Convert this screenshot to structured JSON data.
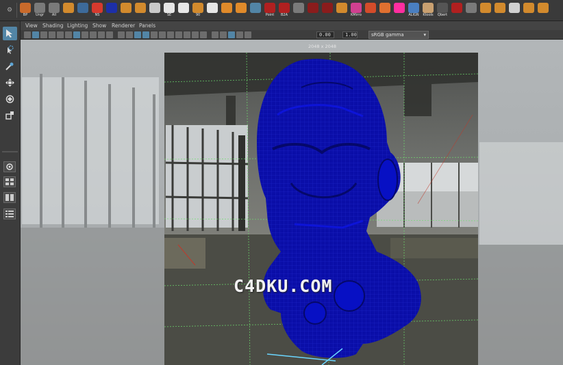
{
  "shelf": {
    "buttons": [
      {
        "label": "BP",
        "icon": "axis-arrows-icon",
        "color": "#c96a2b"
      },
      {
        "label": "Ungr",
        "icon": "ungroup-icon",
        "color": "#7a7a7a"
      },
      {
        "label": "All",
        "icon": "select-all-icon",
        "color": "#7a7a7a"
      },
      {
        "label": "",
        "icon": "grid-tiles-icon",
        "color": "#d28a2d"
      },
      {
        "label": "",
        "icon": "checker-icon",
        "color": "#3d6a9a"
      },
      {
        "label": "NS",
        "icon": "red-cylinder-icon",
        "color": "#d63a2e"
      },
      {
        "label": "",
        "icon": "blue-panel-icon",
        "color": "#1d2fa8"
      },
      {
        "label": "",
        "icon": "sphere-orange-icon",
        "color": "#d28a2d"
      },
      {
        "label": "",
        "icon": "sphere-orange-icon",
        "color": "#d28a2d"
      },
      {
        "label": "",
        "icon": "globe-icon",
        "color": "#c9c9c9"
      },
      {
        "label": "SE",
        "icon": "tiles-icon",
        "color": "#e6e6e6"
      },
      {
        "label": "",
        "icon": "grid-dots-icon",
        "color": "#e6e6e6"
      },
      {
        "label": "90",
        "icon": "rotate-icon",
        "color": "#d28a2d"
      },
      {
        "label": "",
        "icon": "brush-icon",
        "color": "#e6e6e6"
      },
      {
        "label": "",
        "icon": "palette-icon",
        "color": "#e08a2a"
      },
      {
        "label": "",
        "icon": "paint-icon",
        "color": "#e08a2a"
      },
      {
        "label": "",
        "icon": "brush-blue-icon",
        "color": "#5285a6"
      },
      {
        "label": "Point",
        "icon": "point-icon",
        "color": "#b02020"
      },
      {
        "label": "B2A",
        "icon": "b2a-icon",
        "color": "#b02020"
      },
      {
        "label": "",
        "icon": "transfer-icon",
        "color": "#7a7a7a"
      },
      {
        "label": "",
        "icon": "bracket-icon",
        "color": "#8a1c1c"
      },
      {
        "label": "",
        "icon": "pivot-icon",
        "color": "#8a1c1c"
      },
      {
        "label": "",
        "icon": "columns-icon",
        "color": "#d28a2d"
      },
      {
        "label": "KMirro",
        "icon": "mirror-icon",
        "color": "#d04090"
      },
      {
        "label": "",
        "icon": "link-icon",
        "color": "#d44c2a"
      },
      {
        "label": "",
        "icon": "ring-icon",
        "color": "#e07030"
      },
      {
        "label": "",
        "icon": "pink-blob-icon",
        "color": "#ff2ea0"
      },
      {
        "label": "ALIGN",
        "icon": "align-icon",
        "color": "#4a7fc0"
      },
      {
        "label": "Ktools",
        "icon": "ktools-icon",
        "color": "#c9a070"
      },
      {
        "label": "Qbert",
        "icon": "qbert-icon",
        "color": "#555"
      },
      {
        "label": "",
        "icon": "hammer-icon",
        "color": "#b02020"
      },
      {
        "label": "",
        "icon": "close-box-icon",
        "color": "#7a7a7a"
      },
      {
        "label": "",
        "icon": "tool-icon",
        "color": "#d28a2d"
      },
      {
        "label": "",
        "icon": "curve-icon",
        "color": "#d28a2d"
      },
      {
        "label": "",
        "icon": "arrow-icon",
        "color": "#d0d0d0"
      },
      {
        "label": "",
        "icon": "cube-icon",
        "color": "#d28a2d"
      },
      {
        "label": "",
        "icon": "cube-icon",
        "color": "#d28a2d"
      }
    ]
  },
  "panel_menu": [
    "View",
    "Shading",
    "Lighting",
    "Show",
    "Renderer",
    "Panels"
  ],
  "panel_toolbar": {
    "exposure": "0.00",
    "gamma": "1.00",
    "color_space": "sRGB gamma"
  },
  "viewport": {
    "resolution_label": "2048 x 2048",
    "watermark": "C4DKU.COM",
    "mesh_color": "#0a0ea8"
  }
}
